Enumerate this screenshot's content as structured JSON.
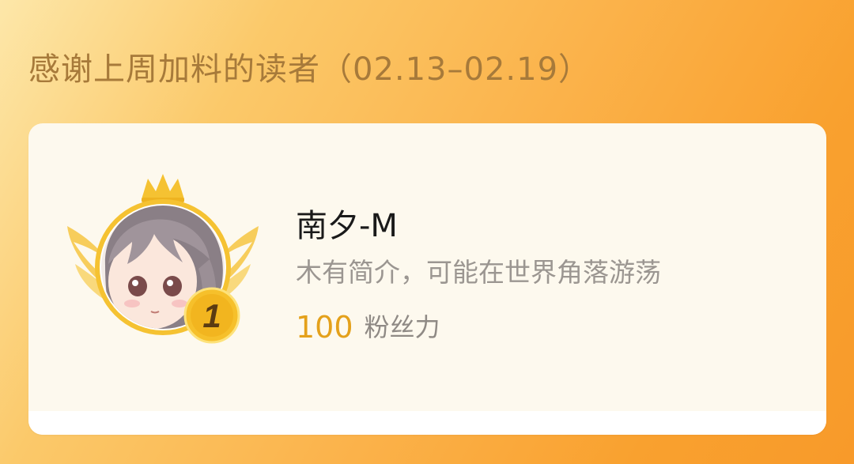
{
  "header": {
    "title": "感谢上周加料的读者（02.13–02.19）"
  },
  "reader_card": {
    "rank": "1",
    "name": "南夕-M",
    "bio": "木有简介，可能在世界角落游荡",
    "fan_value": "100",
    "fan_unit": "粉丝力",
    "avatar_icon": "anime-avatar",
    "badge_icon": "crown-wings-badge"
  },
  "colors": {
    "title": "#a77a3a",
    "fan_value": "#e4a11b",
    "badge_gold": "#f3c12b",
    "card_background": "#fdf9ee"
  }
}
